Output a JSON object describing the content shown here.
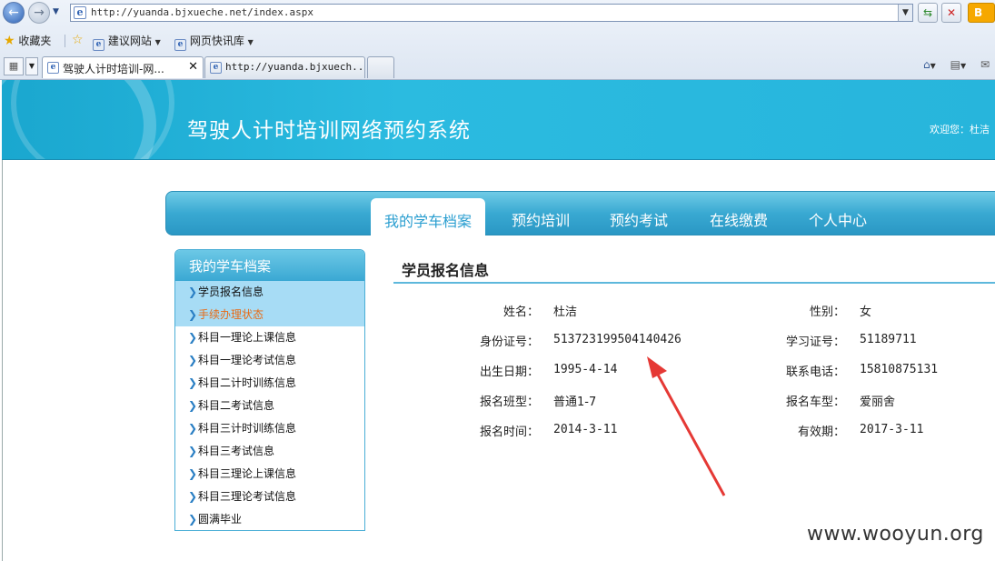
{
  "browser": {
    "url": "http://yuanda.bjxueche.net/index.aspx",
    "favorites_label": "收藏夹",
    "fav_links": [
      "建议网站",
      "网页快讯库"
    ],
    "tabs": [
      {
        "label": "驾驶人计时培训-网...",
        "active": true
      },
      {
        "label": "http://yuanda.bjxuech..."
      }
    ],
    "bing_label": "B"
  },
  "site": {
    "title": "驾驶人计时培训网络预约系统",
    "welcome": "欢迎您：杜洁"
  },
  "nav": {
    "active": "我的学车档案",
    "items": [
      "预约培训",
      "预约考试",
      "在线缴费",
      "个人中心"
    ]
  },
  "sidebar": {
    "title": "我的学车档案",
    "items": [
      {
        "label": "学员报名信息",
        "state": "highlighted"
      },
      {
        "label": "手续办理状态",
        "state": "highlighted-orange"
      },
      {
        "label": "科目一理论上课信息"
      },
      {
        "label": "科目一理论考试信息"
      },
      {
        "label": "科目二计时训练信息"
      },
      {
        "label": "科目二考试信息"
      },
      {
        "label": "科目三计时训练信息"
      },
      {
        "label": "科目三考试信息"
      },
      {
        "label": "科目三理论上课信息"
      },
      {
        "label": "科目三理论考试信息"
      },
      {
        "label": "圆满毕业"
      }
    ]
  },
  "content": {
    "title": "学员报名信息",
    "rows": [
      {
        "left_label": "姓名：",
        "left_value": "杜洁",
        "right_label": "性别：",
        "right_value": "女"
      },
      {
        "left_label": "身份证号：",
        "left_value": "513723199504140426",
        "right_label": "学习证号：",
        "right_value": "51189711"
      },
      {
        "left_label": "出生日期：",
        "left_value": "1995-4-14",
        "right_label": "联系电话：",
        "right_value": "15810875131"
      },
      {
        "left_label": "报名班型：",
        "left_value": "普通1-7",
        "right_label": "报名车型：",
        "right_value": "爱丽舍"
      },
      {
        "left_label": "报名时间：",
        "left_value": "2014-3-11",
        "right_label": "有效期：",
        "right_value": "2017-3-11"
      }
    ]
  },
  "annotation": {
    "color": "#e53935"
  },
  "watermark": "www.wooyun.org",
  "colors": {
    "banner": "#27b5dc",
    "accent": "#2a9ed0",
    "highlight": "#a7dcf5",
    "orange": "#e86a14"
  }
}
